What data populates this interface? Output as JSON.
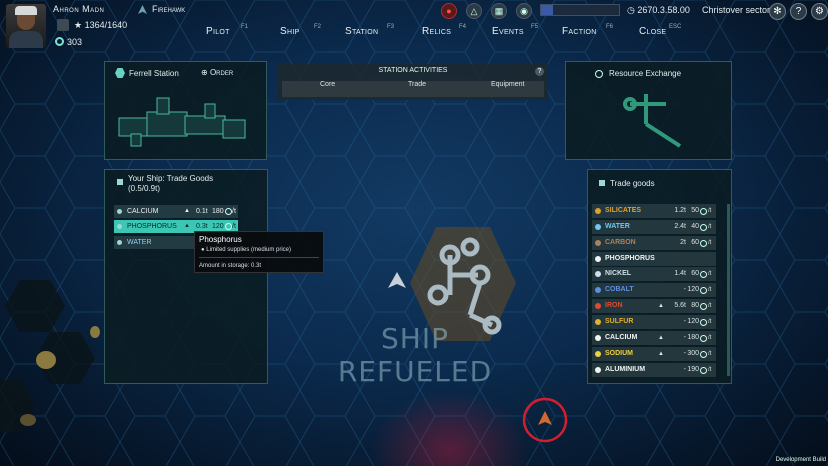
{
  "pilot": {
    "name": "Ahron Madn",
    "hp": "1364/1640",
    "credits": "303"
  },
  "ship": {
    "name": "Firehawk"
  },
  "topbar": {
    "time": "2670.3.58.00",
    "sector": "Christover sector",
    "fuel_fraction": 0.15
  },
  "nav": [
    {
      "label": "Pilot",
      "key": "F1"
    },
    {
      "label": "Ship",
      "key": "F2"
    },
    {
      "label": "Station",
      "key": "F3"
    },
    {
      "label": "Relics",
      "key": "F4"
    },
    {
      "label": "Events",
      "key": "F5"
    },
    {
      "label": "Faction",
      "key": "F6"
    },
    {
      "label": "Close",
      "key": "ESC"
    }
  ],
  "station_panel": {
    "title": "Ferrell Station",
    "order_label": "Order"
  },
  "activities": {
    "title": "STATION ACTIVITIES",
    "help": "?",
    "tabs": [
      "Core",
      "Trade",
      "Equipment"
    ]
  },
  "exchange_panel": {
    "title": "Resource Exchange"
  },
  "your_goods": {
    "title": "Your Ship: Trade Goods",
    "capacity": "(0.5/0.9t)",
    "rows": [
      {
        "name": "CALCIUM",
        "qty": "0.1t",
        "price": "180",
        "unit": "/t",
        "color": "#e8eef0"
      },
      {
        "name": "PHOSPHORUS",
        "qty": "0.3t",
        "price": "120",
        "unit": "/t",
        "color": "#052a2a"
      },
      {
        "name": "WATER",
        "qty": "",
        "price": "",
        "unit": "",
        "color": "#8fd0f0"
      }
    ]
  },
  "tooltip": {
    "title": "Phosphorus",
    "supply": "Limited supplies (medium price)",
    "storage": "Amount in storage: 0.3t"
  },
  "trade_goods": {
    "title": "Trade goods",
    "rows": [
      {
        "name": "SILICATES",
        "qty": "1.2t",
        "price": "50",
        "unit": "/t",
        "color": "#e0a030"
      },
      {
        "name": "WATER",
        "qty": "2.4t",
        "price": "40",
        "unit": "/t",
        "color": "#6fc8f0"
      },
      {
        "name": "CARBON",
        "qty": "2t",
        "price": "60",
        "unit": "/t",
        "color": "#b0805a"
      },
      {
        "name": "PHOSPHORUS",
        "qty": "",
        "price": "",
        "unit": "",
        "color": "#f0f4f4"
      },
      {
        "name": "NICKEL",
        "qty": "1.4t",
        "price": "60",
        "unit": "/t",
        "color": "#cfe0e8"
      },
      {
        "name": "COBALT",
        "qty": "-",
        "price": "120",
        "unit": "/t",
        "color": "#5f8fe0"
      },
      {
        "name": "IRON",
        "qty": "5.6t",
        "price": "80",
        "unit": "/t",
        "color": "#e04a30"
      },
      {
        "name": "SULFUR",
        "qty": "-",
        "price": "120",
        "unit": "/t",
        "color": "#e0b030"
      },
      {
        "name": "CALCIUM",
        "qty": "-",
        "price": "180",
        "unit": "/t",
        "color": "#f0f4f4"
      },
      {
        "name": "SODIUM",
        "qty": "-",
        "price": "300",
        "unit": "/t",
        "color": "#f0d040"
      },
      {
        "name": "ALUMINIUM",
        "qty": "-",
        "price": "190",
        "unit": "/t",
        "color": "#f0f4f4"
      }
    ]
  },
  "status_message": "SHIP REFUELED",
  "dev_build": "Development Build"
}
